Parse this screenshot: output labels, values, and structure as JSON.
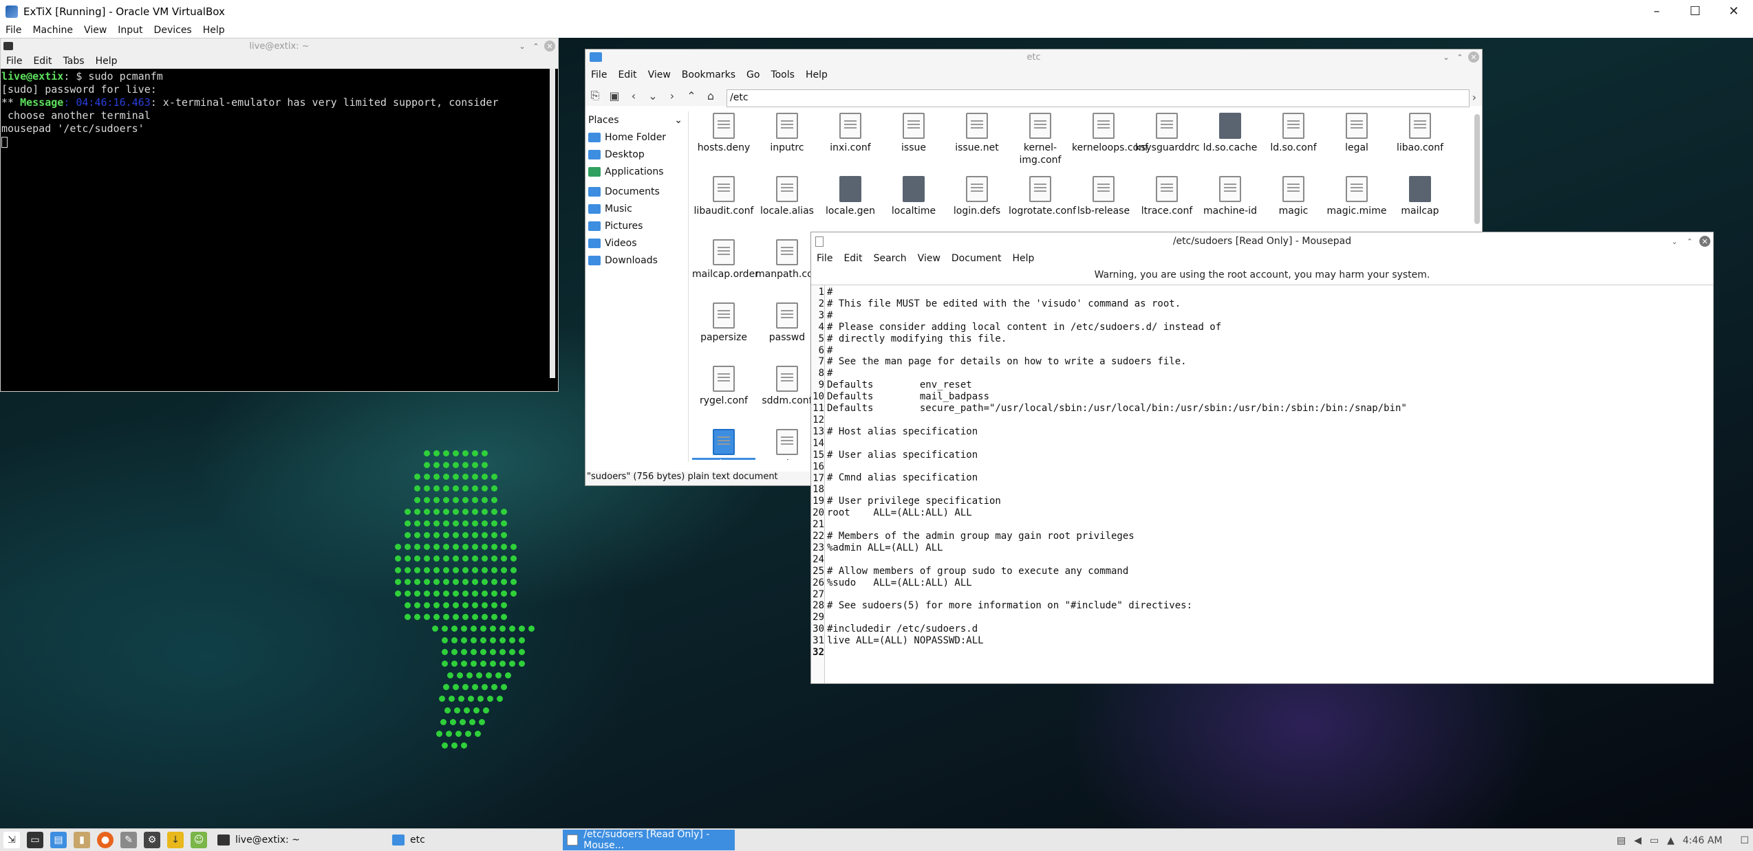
{
  "vbox": {
    "title": "ExTiX [Running] - Oracle VM VirtualBox",
    "menu": [
      "File",
      "Machine",
      "View",
      "Input",
      "Devices",
      "Help"
    ],
    "controls": [
      "–",
      "☐",
      "✕"
    ]
  },
  "terminal": {
    "title": "live@extix: ~",
    "menu": [
      "File",
      "Edit",
      "Tabs",
      "Help"
    ],
    "prompt_user": "live@extix",
    "prompt_rest": ": $ sudo pcmanfm",
    "line2": "[sudo] password for live:",
    "msg_prefix": "** ",
    "msg_word": "Message",
    "msg_time": ": 04:46:16.463",
    "msg_text": ": x-terminal-emulator has very limited support, consider",
    "line4": " choose another terminal",
    "line5": "mousepad '/etc/sudoers'"
  },
  "filemanager": {
    "title": "etc",
    "menu": [
      "File",
      "Edit",
      "View",
      "Bookmarks",
      "Go",
      "Tools",
      "Help"
    ],
    "path": "/etc",
    "places_header": "Places",
    "places": [
      {
        "label": "Home Folder",
        "color": "#3d8ee0"
      },
      {
        "label": "Desktop",
        "color": "#3d8ee0"
      },
      {
        "label": "Applications",
        "color": "#2fa060"
      },
      {
        "label": "Documents",
        "color": "#3d8ee0"
      },
      {
        "label": "Music",
        "color": "#3d8ee0"
      },
      {
        "label": "Pictures",
        "color": "#3d8ee0"
      },
      {
        "label": "Videos",
        "color": "#3d8ee0"
      },
      {
        "label": "Downloads",
        "color": "#3d8ee0"
      }
    ],
    "files_row1": [
      "hosts.deny",
      "inputrc",
      "inxi.conf",
      "issue",
      "issue.net",
      "kernel-img.conf",
      "kerneloops.conf",
      "ksysguarddrc",
      "ld.so.cache",
      "ld.so.conf",
      "legal",
      "libao.conf"
    ],
    "files_row2": [
      "libaudit.conf",
      "locale.alias",
      "locale.gen",
      "localtime",
      "login.defs",
      "logrotate.conf",
      "lsb-release",
      "ltrace.conf",
      "machine-id",
      "magic",
      "magic.mime",
      "mailcap"
    ],
    "files_col": [
      "mailcap.order",
      "manpath.config",
      "papersize",
      "passwd",
      "rygel.conf",
      "sddm.conf",
      "sudoers",
      "sysctl.conf"
    ],
    "status": "\"sudoers\" (756 bytes) plain text document"
  },
  "mousepad": {
    "title": "/etc/sudoers [Read Only] - Mousepad",
    "menu": [
      "File",
      "Edit",
      "Search",
      "View",
      "Document",
      "Help"
    ],
    "warning": "Warning, you are using the root account, you may harm your system.",
    "lines": [
      "#",
      "# This file MUST be edited with the 'visudo' command as root.",
      "#",
      "# Please consider adding local content in /etc/sudoers.d/ instead of",
      "# directly modifying this file.",
      "#",
      "# See the man page for details on how to write a sudoers file.",
      "#",
      "Defaults        env_reset",
      "Defaults        mail_badpass",
      "Defaults        secure_path=\"/usr/local/sbin:/usr/local/bin:/usr/sbin:/usr/bin:/sbin:/bin:/snap/bin\"",
      "",
      "# Host alias specification",
      "",
      "# User alias specification",
      "",
      "# Cmnd alias specification",
      "",
      "# User privilege specification",
      "root    ALL=(ALL:ALL) ALL",
      "",
      "# Members of the admin group may gain root privileges",
      "%admin ALL=(ALL) ALL",
      "",
      "# Allow members of group sudo to execute any command",
      "%sudo   ALL=(ALL:ALL) ALL",
      "",
      "# See sudoers(5) for more information on \"#include\" directives:",
      "",
      "#includedir /etc/sudoers.d",
      "live ALL=(ALL) NOPASSWD:ALL",
      ""
    ]
  },
  "taskbar": {
    "tasks": [
      {
        "label": "live@extix: ~",
        "active": false
      },
      {
        "label": "etc",
        "active": false
      },
      {
        "label": "/etc/sudoers [Read Only] - Mouse...",
        "active": true
      }
    ],
    "clock": "4:46 AM"
  }
}
